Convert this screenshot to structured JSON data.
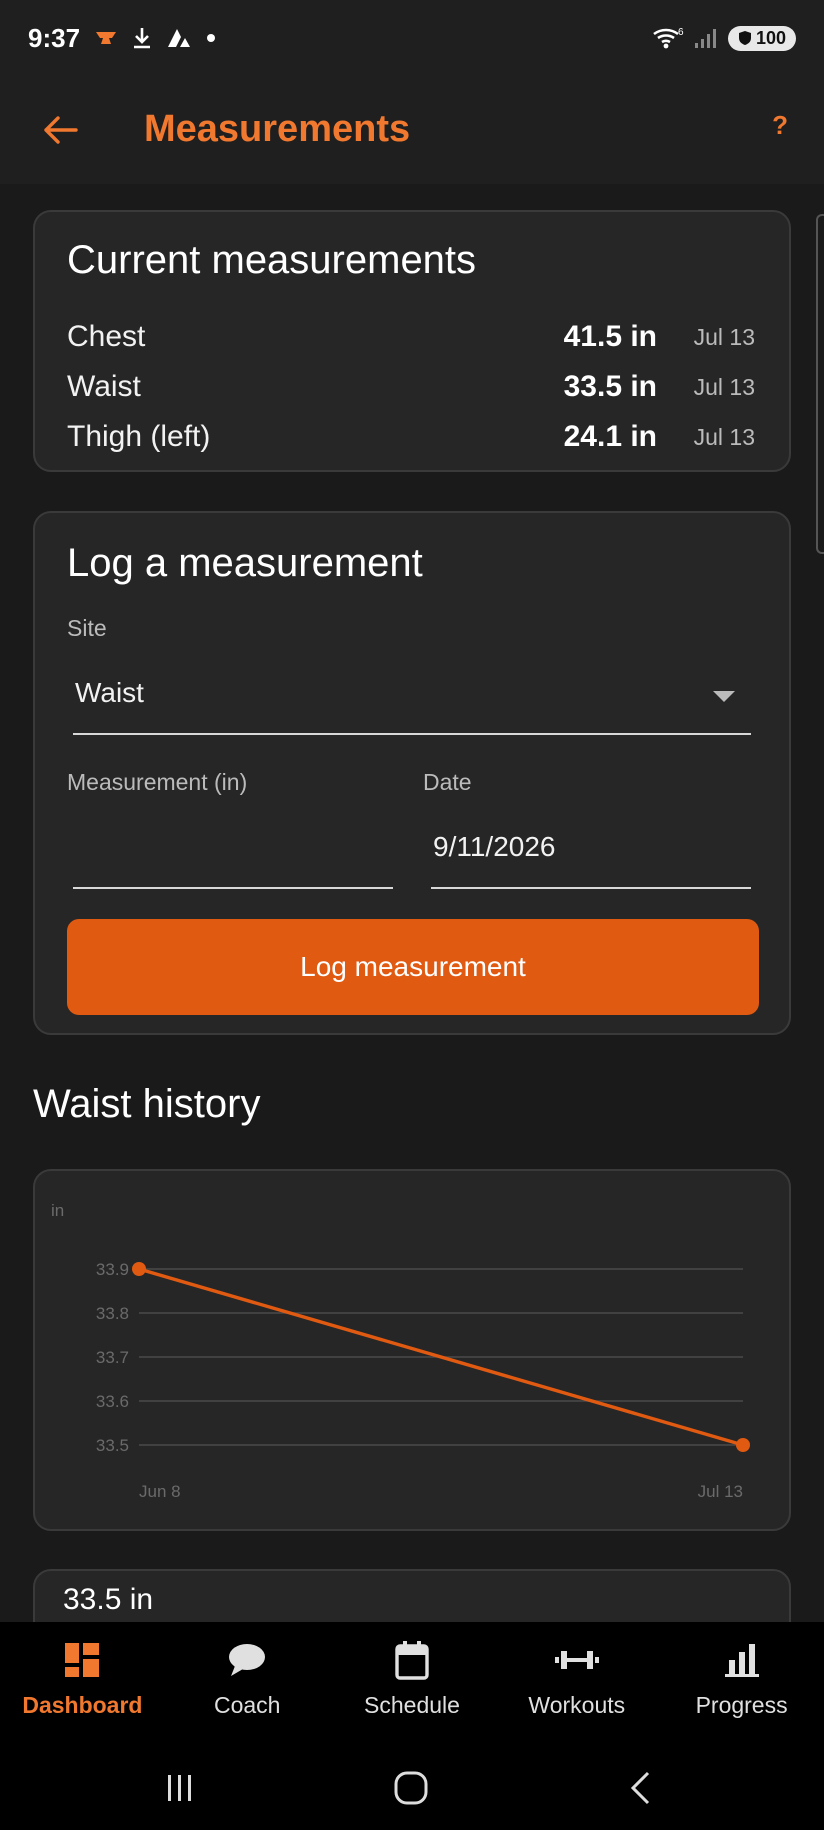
{
  "status_bar": {
    "time": "9:37",
    "signal_badge": "6",
    "battery": "100"
  },
  "app_bar": {
    "title": "Measurements",
    "help": "?"
  },
  "current_card": {
    "title": "Current measurements",
    "rows": [
      {
        "name": "Chest",
        "value": "41.5 in",
        "date": "Jul 13"
      },
      {
        "name": "Waist",
        "value": "33.5 in",
        "date": "Jul 13"
      },
      {
        "name": "Thigh (left)",
        "value": "24.1 in",
        "date": "Jul 13"
      }
    ]
  },
  "log_card": {
    "title": "Log a measurement",
    "site_label": "Site",
    "site_value": "Waist",
    "measurement_label": "Measurement (in)",
    "measurement_value": "",
    "date_label": "Date",
    "date_value": "9/11/2026",
    "button_label": "Log measurement"
  },
  "history": {
    "title": "Waist history"
  },
  "chart_data": {
    "type": "line",
    "ylabel": "in",
    "x": [
      "Jun 8",
      "Jul 13"
    ],
    "series": [
      {
        "values": [
          33.9,
          33.5
        ]
      }
    ],
    "yticks": [
      "33.9",
      "33.8",
      "33.7",
      "33.6",
      "33.5"
    ],
    "ylim": [
      33.5,
      33.9
    ],
    "grid": true,
    "color": "#e05a12"
  },
  "next_card": {
    "value": "33.5 in"
  },
  "bottom_nav": {
    "items": [
      {
        "label": "Dashboard",
        "icon": "dashboard-icon",
        "active": true
      },
      {
        "label": "Coach",
        "icon": "chat-bubble-icon",
        "active": false
      },
      {
        "label": "Schedule",
        "icon": "calendar-icon",
        "active": false
      },
      {
        "label": "Workouts",
        "icon": "dumbbell-icon",
        "active": false
      },
      {
        "label": "Progress",
        "icon": "bar-chart-icon",
        "active": false
      }
    ]
  },
  "colors": {
    "accent": "#f0782f",
    "button": "#e05a12",
    "background": "#1a1a1a",
    "card": "#262626"
  }
}
